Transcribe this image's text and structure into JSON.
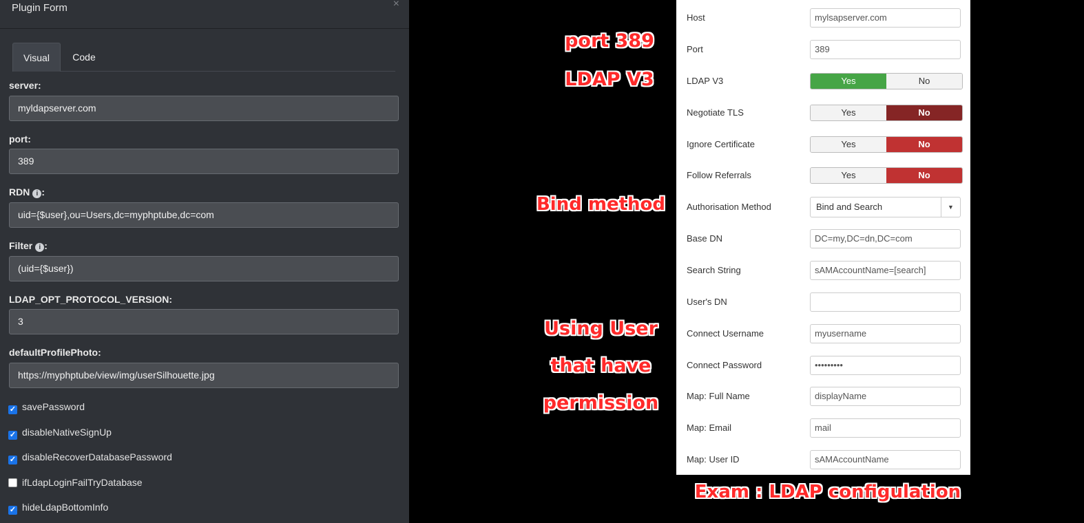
{
  "plugin_form": {
    "title": "Plugin Form",
    "close_icon": "×",
    "tabs": [
      "Visual",
      "Code"
    ],
    "fields": [
      {
        "label": "server:",
        "value": "myldapserver.com"
      },
      {
        "label": "port:",
        "value": "389"
      },
      {
        "label": "RDN",
        "suffix": ":",
        "value": "uid={$user},ou=Users,dc=myphptube,dc=com"
      },
      {
        "label": "Filter",
        "suffix": ":",
        "value": "(uid={$user})"
      },
      {
        "label": "LDAP_OPT_PROTOCOL_VERSION:",
        "value": "3"
      },
      {
        "label": "defaultProfilePhoto:",
        "value": "https://myphptube/view/img/userSilhouette.jpg"
      }
    ],
    "checkboxes": [
      {
        "label": "savePassword",
        "checked": true
      },
      {
        "label": "disableNativeSignUp",
        "checked": true
      },
      {
        "label": "disableRecoverDatabasePassword",
        "checked": true
      },
      {
        "label": "ifLdapLoginFailTryDatabase",
        "checked": false
      },
      {
        "label": "hideLdapBottomInfo",
        "checked": true
      }
    ]
  },
  "annotations": {
    "port": "port 389",
    "ldap_v3": "LDAP V3",
    "bind": "Bind method",
    "user_line1": "Using User",
    "user_line2": "that have",
    "user_line3": "permission",
    "caption": "Exam : LDAP configulation"
  },
  "ldap_form": {
    "host": {
      "label": "Host",
      "value": "mylsapserver.com"
    },
    "port": {
      "label": "Port",
      "value": "389"
    },
    "ldap_v3": {
      "label": "LDAP V3",
      "yes": "Yes",
      "no": "No",
      "selected": "Yes"
    },
    "negotiate_tls": {
      "label": "Negotiate TLS",
      "yes": "Yes",
      "no": "No",
      "selected": "No"
    },
    "ignore_cert": {
      "label": "Ignore Certificate",
      "yes": "Yes",
      "no": "No",
      "selected": "No"
    },
    "follow_referrals": {
      "label": "Follow Referrals",
      "yes": "Yes",
      "no": "No",
      "selected": "No"
    },
    "auth_method": {
      "label": "Authorisation Method",
      "value": "Bind and Search"
    },
    "base_dn": {
      "label": "Base DN",
      "value": "DC=my,DC=dn,DC=com"
    },
    "search_string": {
      "label": "Search String",
      "value": "sAMAccountName=[search]"
    },
    "users_dn": {
      "label": "User's DN",
      "value": ""
    },
    "connect_username": {
      "label": "Connect Username",
      "value": "myusername"
    },
    "connect_password": {
      "label": "Connect Password",
      "value": "•••••••••"
    },
    "map_full_name": {
      "label": "Map: Full Name",
      "value": "displayName"
    },
    "map_email": {
      "label": "Map: Email",
      "value": "mail"
    },
    "map_user_id": {
      "label": "Map: User ID",
      "value": "sAMAccountName"
    }
  },
  "colors": {
    "panel_bg": "#2f3237",
    "toggle_yes": "#46a546",
    "toggle_no_dark": "#852525",
    "toggle_no": "#c03232",
    "annotation": "#ff2a2a"
  }
}
